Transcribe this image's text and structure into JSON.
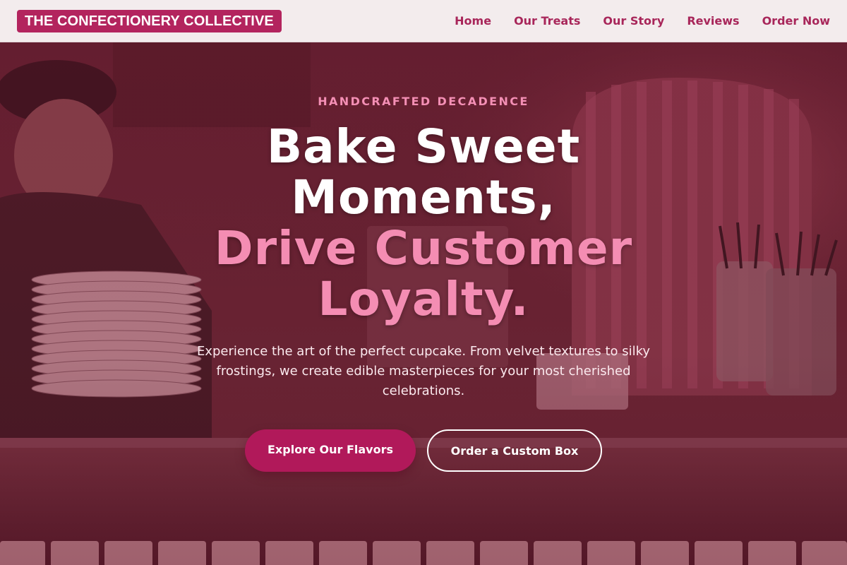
{
  "header": {
    "logo": "THE CONFECTIONERY COLLECTIVE",
    "nav": [
      {
        "label": "Home"
      },
      {
        "label": "Our Treats"
      },
      {
        "label": "Our Story"
      },
      {
        "label": "Reviews"
      },
      {
        "label": "Order Now"
      }
    ]
  },
  "hero": {
    "eyebrow": "HANDCRAFTED DECADENCE",
    "headline_white_1": "Bake Sweet",
    "headline_white_2": "Moments,",
    "headline_pink_1": "Drive Customer",
    "headline_pink_2": "Loyalty.",
    "subtext": "Experience the art of the perfect cupcake. From velvet textures to silky frostings, we create edible masterpieces for your most cherished celebrations.",
    "primary_button": "Explore Our Flavors",
    "secondary_button": "Order a Custom Box"
  },
  "colors": {
    "brand": "#b3245e",
    "nav_text": "#a8265a",
    "accent_pink": "#f48db3",
    "header_bg": "#f3eced"
  }
}
